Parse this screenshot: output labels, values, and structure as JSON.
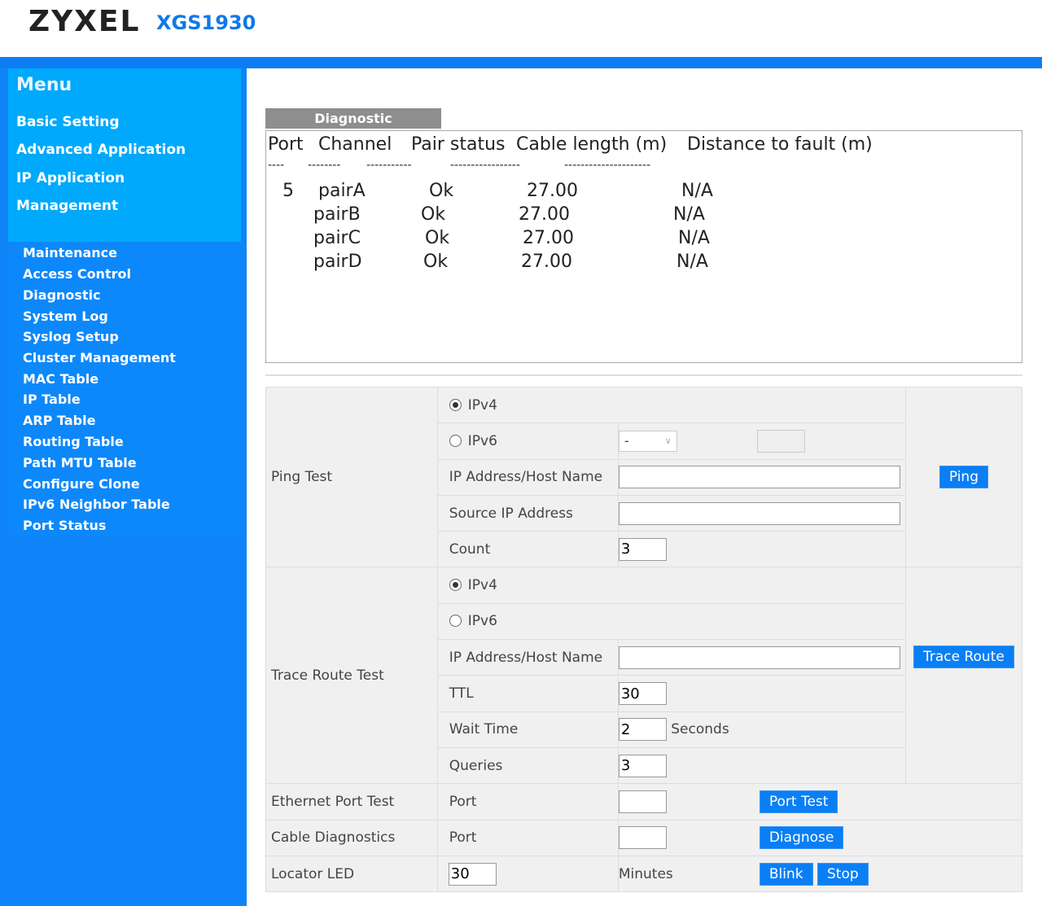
{
  "header": {
    "logo": "ZYXEL",
    "model": "XGS1930"
  },
  "menu": {
    "title": "Menu",
    "items": [
      "Basic Setting",
      "Advanced Application",
      "IP Application",
      "Management"
    ],
    "sub_items": [
      "Maintenance",
      "Access Control",
      "Diagnostic",
      "System Log",
      "Syslog Setup",
      "Cluster Management",
      "MAC Table",
      "IP Table",
      "ARP Table",
      "Routing Table",
      "Path MTU Table",
      "Configure Clone",
      "IPv6 Neighbor Table",
      "Port Status"
    ]
  },
  "diagnostic": {
    "tab": "Diagnostic",
    "headers": [
      "Port",
      "Channel",
      "Pair status",
      "Cable length (m)",
      "Distance to fault (m)"
    ],
    "dashes": [
      "----",
      "--------",
      "-----------",
      "-----------------",
      "---------------------"
    ],
    "rows": [
      [
        "5",
        "pairA",
        "Ok",
        "27.00",
        "N/A"
      ],
      [
        "",
        "pairB",
        "Ok",
        "27.00",
        "N/A"
      ],
      [
        "",
        "pairC",
        "Ok",
        "27.00",
        "N/A"
      ],
      [
        "",
        "pairD",
        "Ok",
        "27.00",
        "N/A"
      ]
    ]
  },
  "ping": {
    "label": "Ping Test",
    "ipv4": "IPv4",
    "ipv6": "IPv6",
    "ipv6_select": "-",
    "host_label": "IP Address/Host Name",
    "host_value": "",
    "source_label": "Source IP Address",
    "source_value": "",
    "count_label": "Count",
    "count_value": "3",
    "button": "Ping"
  },
  "trace": {
    "label": "Trace Route Test",
    "ipv4": "IPv4",
    "ipv6": "IPv6",
    "host_label": "IP Address/Host Name",
    "host_value": "",
    "ttl_label": "TTL",
    "ttl_value": "30",
    "wait_label": "Wait Time",
    "wait_value": "2",
    "wait_unit": "Seconds",
    "queries_label": "Queries",
    "queries_value": "3",
    "button": "Trace Route"
  },
  "ethernet": {
    "label": "Ethernet Port Test",
    "port_label": "Port",
    "port_value": "",
    "button": "Port Test"
  },
  "cable": {
    "label": "Cable Diagnostics",
    "port_label": "Port",
    "port_value": "",
    "button": "Diagnose"
  },
  "locator": {
    "label": "Locator LED",
    "value": "30",
    "unit": "Minutes",
    "blink": "Blink",
    "stop": "Stop"
  }
}
